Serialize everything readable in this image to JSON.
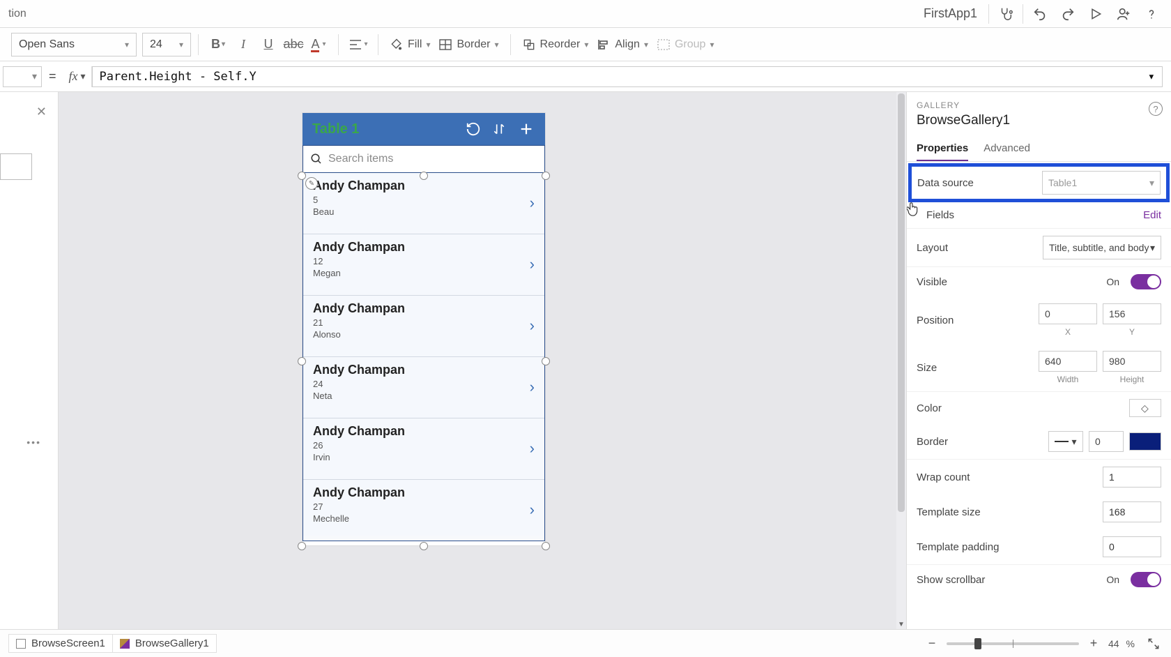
{
  "titlebar": {
    "left_fragment": "tion",
    "app_name": "FirstApp1"
  },
  "toolbar": {
    "font": "Open Sans",
    "font_size": "24",
    "fill_label": "Fill",
    "border_label": "Border",
    "reorder_label": "Reorder",
    "align_label": "Align",
    "group_label": "Group"
  },
  "formula": {
    "equals": "=",
    "text": "Parent.Height - Self.Y"
  },
  "phone": {
    "title": "Table 1",
    "search_placeholder": "Search items",
    "items": [
      {
        "title": "Andy Champan",
        "subtitle": "5",
        "body": "Beau"
      },
      {
        "title": "Andy Champan",
        "subtitle": "12",
        "body": "Megan"
      },
      {
        "title": "Andy Champan",
        "subtitle": "21",
        "body": "Alonso"
      },
      {
        "title": "Andy Champan",
        "subtitle": "24",
        "body": "Neta"
      },
      {
        "title": "Andy Champan",
        "subtitle": "26",
        "body": "Irvin"
      },
      {
        "title": "Andy Champan",
        "subtitle": "27",
        "body": "Mechelle"
      }
    ]
  },
  "panel": {
    "category": "GALLERY",
    "name": "BrowseGallery1",
    "tabs": {
      "properties": "Properties",
      "advanced": "Advanced"
    },
    "data_source_label": "Data source",
    "data_source_value": "Table1",
    "fields_label": "Fields",
    "fields_edit": "Edit",
    "layout_label": "Layout",
    "layout_value": "Title, subtitle, and body",
    "visible_label": "Visible",
    "visible_value": "On",
    "position_label": "Position",
    "position_x": "0",
    "position_x_lbl": "X",
    "position_y": "156",
    "position_y_lbl": "Y",
    "size_label": "Size",
    "size_w": "640",
    "size_w_lbl": "Width",
    "size_h": "980",
    "size_h_lbl": "Height",
    "color_label": "Color",
    "border_label": "Border",
    "border_width": "0",
    "wrap_label": "Wrap count",
    "wrap_value": "1",
    "template_size_label": "Template size",
    "template_size_value": "168",
    "template_padding_label": "Template padding",
    "template_padding_value": "0",
    "scrollbar_label": "Show scrollbar",
    "scrollbar_value": "On"
  },
  "status": {
    "crumb1": "BrowseScreen1",
    "crumb2": "BrowseGallery1",
    "zoom_value": "44",
    "zoom_pct": "%"
  }
}
